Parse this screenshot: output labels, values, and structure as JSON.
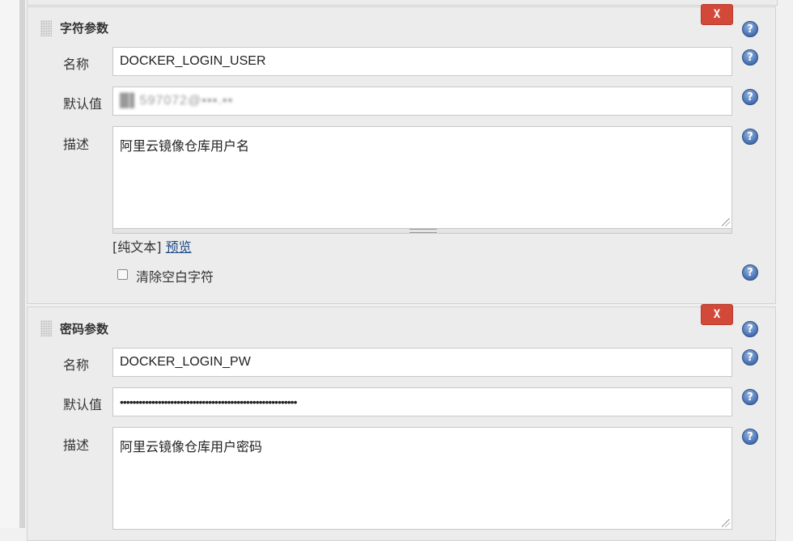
{
  "colors": {
    "delete_button": "#d24939",
    "help_icon": "#4f78b8",
    "link": "#204a87"
  },
  "icons": {
    "drag_handle": "drag-handle-icon",
    "help": "help-icon",
    "delete": "delete-x-button"
  },
  "sections": [
    {
      "title": "字符参数",
      "delete_label": "X",
      "help_glyph": "?",
      "fields": {
        "name_label": "名称",
        "name_value": "DOCKER_LOGIN_USER",
        "default_label": "默认值",
        "default_value": "█▌597072@▪▪▪.▪▪",
        "description_label": "描述",
        "description_value": "阿里云镜像仓库用户名"
      },
      "markup": {
        "prefix": "[纯文本]",
        "preview_link": "预览"
      },
      "trim": {
        "label": "清除空白字符",
        "checked": false
      }
    },
    {
      "title": "密码参数",
      "delete_label": "X",
      "help_glyph": "?",
      "fields": {
        "name_label": "名称",
        "name_value": "DOCKER_LOGIN_PW",
        "default_label": "默认值",
        "default_value": "••••••••••••••••••••••••••••••••••••••••••••••••••••••••",
        "description_label": "描述",
        "description_value": "阿里云镜像仓库用户密码"
      }
    }
  ]
}
